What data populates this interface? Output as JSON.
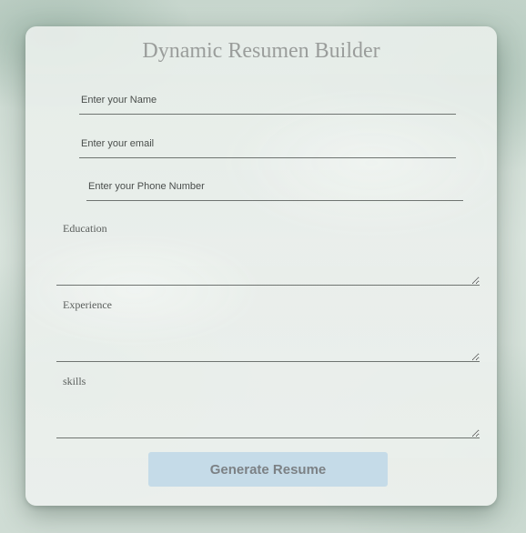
{
  "form": {
    "title": "Dynamic Resumen Builder",
    "name_placeholder": "Enter your Name",
    "email_placeholder": "Enter your email",
    "phone_placeholder": "Enter your Phone Number",
    "education_placeholder": "Education",
    "experience_placeholder": "Experience",
    "skills_placeholder": "skills",
    "submit_label": "Generate Resume"
  },
  "colors": {
    "button_background": "#c5dbe8",
    "button_text": "#7c8185",
    "title_text": "#9a9d9b"
  }
}
